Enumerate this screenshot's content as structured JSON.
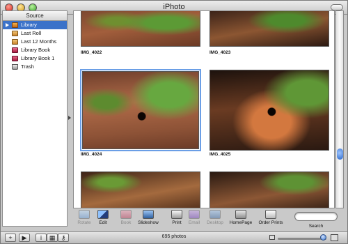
{
  "window": {
    "title": "iPhoto"
  },
  "source": {
    "header": "Source",
    "items": [
      {
        "label": "Library",
        "icon": "library-icon",
        "selected": true
      },
      {
        "label": "Last Roll",
        "icon": "film-roll-icon"
      },
      {
        "label": "Last 12 Months",
        "icon": "film-roll-icon"
      },
      {
        "label": "Library Book",
        "icon": "book-icon"
      },
      {
        "label": "Library Book 1",
        "icon": "book-icon"
      },
      {
        "label": "Trash",
        "icon": "trash-icon"
      }
    ]
  },
  "photos": [
    {
      "label": "IMG_4022"
    },
    {
      "label": "IMG_4023"
    },
    {
      "label": "IMG_4024",
      "selected": true
    },
    {
      "label": "IMG_4025"
    },
    {
      "label": ""
    },
    {
      "label": ""
    }
  ],
  "toolbar": {
    "rotate": "Rotate",
    "edit": "Edit",
    "book": "Book",
    "slideshow": "Slideshow",
    "print": "Print",
    "email": "Email",
    "desktop": "Desktop",
    "homepage": "HomePage",
    "order_prints": "Order Prints",
    "search": "Search"
  },
  "status": {
    "photo_count": "695 photos"
  },
  "colors": {
    "selection": "#3b72c9",
    "photo_selection_border": "#6a9ee6"
  }
}
